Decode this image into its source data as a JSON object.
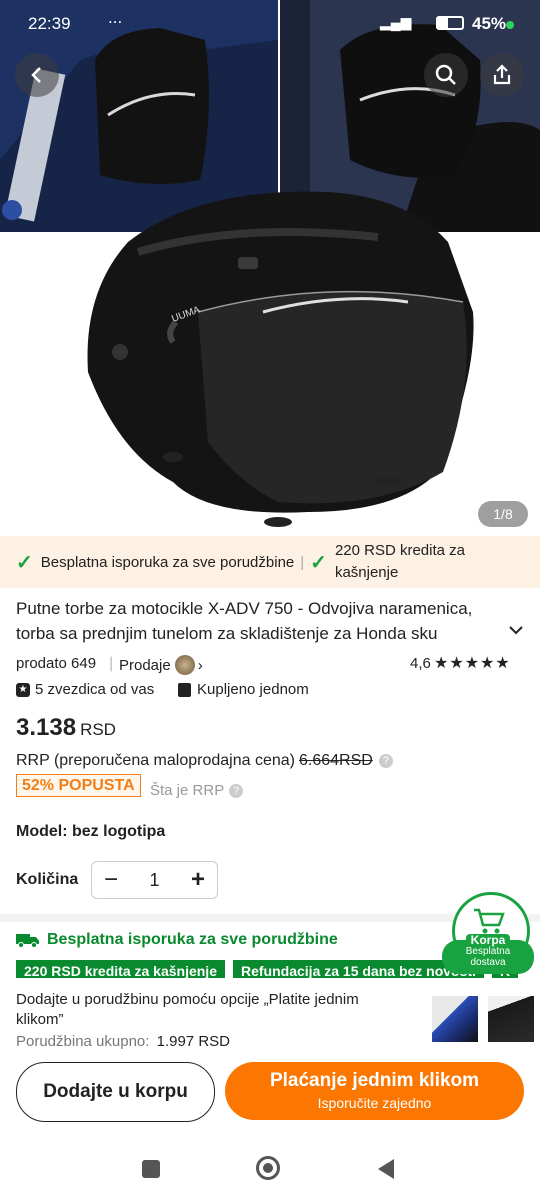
{
  "status": {
    "time": "22:39",
    "dots": "...",
    "battery": "45%"
  },
  "gallery": {
    "counter": "1/8",
    "bag_brand": "UUMA"
  },
  "promo": {
    "free_shipping": "Besplatna isporuka za sve porudžbine",
    "separator": "|",
    "credit": "220 RSD kredita za kašnjenje"
  },
  "product": {
    "title": "Putne torbe za motocikle X-ADV 750 - Odvojiva naramenica, torba sa prednjim tunelom za skladištenje za Honda sku",
    "sold": "prodato 649",
    "seller": "Prodaje",
    "rating": "4,6",
    "five_star_label": "5 zvezdica od vas",
    "bought_label": "Kupljeno jednom",
    "price_number": "3.138",
    "price_currency": "RSD",
    "rrp_label": "RRP (preporučena maloprodajna cena)",
    "rrp_value": "6.664RSD",
    "discount": "52% POPUSTA",
    "what_rrp": "Šta je RRP",
    "model_label": "Model:",
    "model_value": "bez logotipa",
    "qty_label": "Količina",
    "qty_value": "1"
  },
  "benefits": {
    "shipping": "Besplatna isporuka za sve porudžbine",
    "pills": [
      "220 RSD kredita za kašnjenje",
      "Refundacija za 15 dana bez novosti",
      "R"
    ]
  },
  "cart_badge": {
    "title": "Korpa",
    "sub1": "Besplatna",
    "sub2": "dostava"
  },
  "one_click": {
    "text": "Dodajte u porudžbinu pomoću opcije „Platite jednim klikom”",
    "total_label": "Porudžbina ukupno:",
    "total_value": "1.997 RSD"
  },
  "buttons": {
    "add_to_cart": "Dodajte u korpu",
    "pay_one_click": "Plaćanje jednim klikom",
    "pay_sub": "Isporučite zajedno"
  },
  "colors": {
    "accent": "#fb7701",
    "green": "#0a8a2e",
    "promo_bg": "#fdf1e4"
  }
}
